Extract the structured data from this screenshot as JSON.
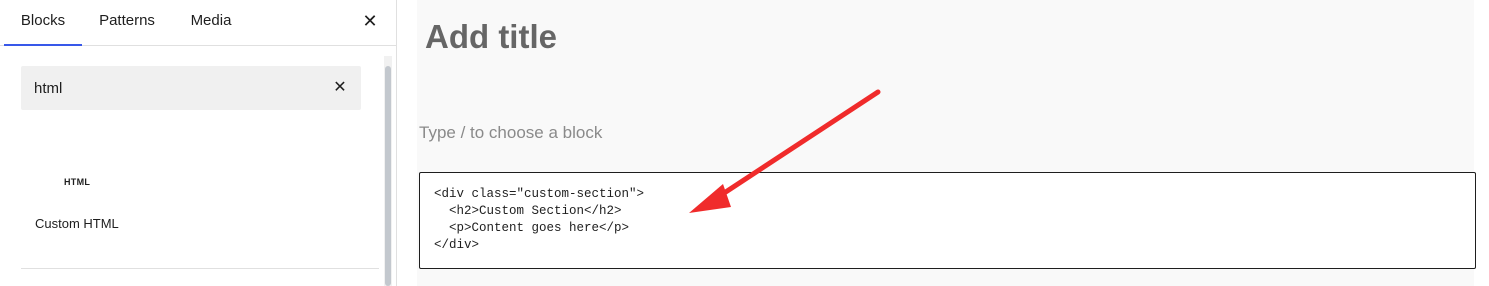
{
  "inserter": {
    "tabs": [
      {
        "label": "Blocks",
        "active": true
      },
      {
        "label": "Patterns",
        "active": false
      },
      {
        "label": "Media",
        "active": false
      }
    ],
    "close_icon": "close-icon",
    "search": {
      "value": "html",
      "clear_icon": "close-icon"
    },
    "results": [
      {
        "icon_text": "HTML",
        "label": "Custom HTML"
      }
    ]
  },
  "editor": {
    "title_placeholder": "Add title",
    "appender_placeholder": "Type / to choose a block",
    "html_block_code": "<div class=\"custom-section\">\n  <h2>Custom Section</h2>\n  <p>Content goes here</p>\n</div>"
  },
  "colors": {
    "accent": "#3858e9",
    "annotation_arrow": "#f02b2b"
  }
}
